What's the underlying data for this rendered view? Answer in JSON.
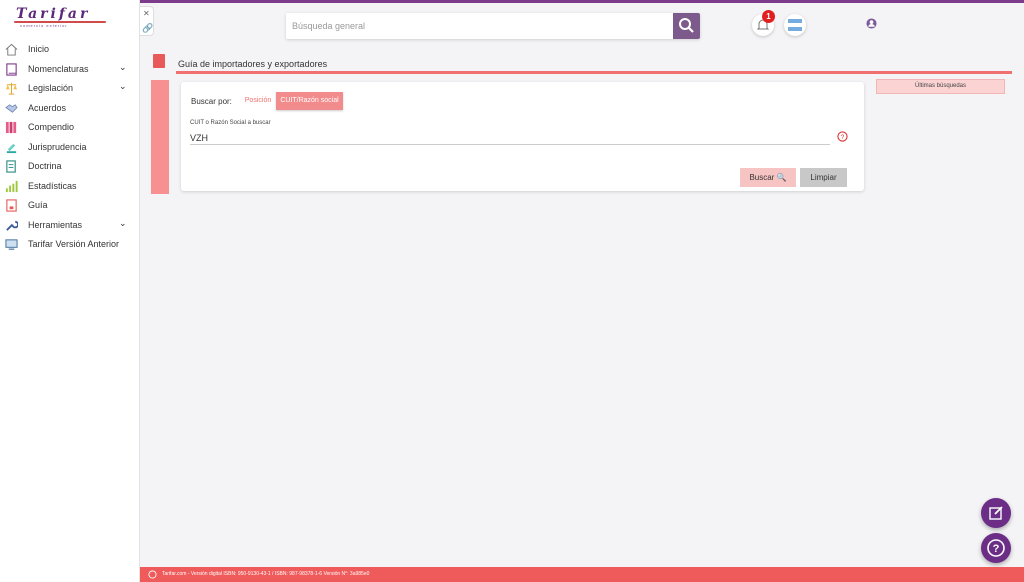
{
  "logo": {
    "name": "Tarifar",
    "tagline": "comercio exterior"
  },
  "sidebar": {
    "items": [
      {
        "label": "Inicio",
        "icon": "home-icon",
        "has_submenu": false
      },
      {
        "label": "Nomenclaturas",
        "icon": "book-icon",
        "has_submenu": true
      },
      {
        "label": "Legislación",
        "icon": "scale-icon",
        "has_submenu": true
      },
      {
        "label": "Acuerdos",
        "icon": "handshake-icon",
        "has_submenu": false
      },
      {
        "label": "Compendio",
        "icon": "books-icon",
        "has_submenu": false
      },
      {
        "label": "Jurisprudencia",
        "icon": "gavel-icon",
        "has_submenu": false
      },
      {
        "label": "Doctrina",
        "icon": "document-icon",
        "has_submenu": false
      },
      {
        "label": "Estadísticas",
        "icon": "chart-icon",
        "has_submenu": false
      },
      {
        "label": "Guía",
        "icon": "guide-icon",
        "has_submenu": false
      },
      {
        "label": "Herramientas",
        "icon": "wrench-icon",
        "has_submenu": true
      },
      {
        "label": "Tarifar Versión Anterior",
        "icon": "monitor-icon",
        "has_submenu": false
      }
    ]
  },
  "header": {
    "search_placeholder": "Búsqueda general",
    "notification_count": "1"
  },
  "page": {
    "title": "Guía de importadores y exportadores"
  },
  "form": {
    "search_by_label": "Buscar por:",
    "options": [
      "Posición",
      "CUIT/Razón social"
    ],
    "selected_option": "CUIT/Razón social",
    "field_label": "CUIT o Razón Social a buscar",
    "field_value": "VZH",
    "search_button": "Buscar",
    "clear_button": "Limpiar"
  },
  "recent_searches_label": "Últimas búsquedas",
  "footer": {
    "text": "Tarifar.com - Versión digital  ISBN: 950-9130-43-1 /  ISBN: 987-98378-1-6    Versión N°: 3a985e0"
  },
  "colors": {
    "primary": "#6b2d86",
    "accent": "#ef5a5a",
    "accent_light": "#f28b8b"
  }
}
